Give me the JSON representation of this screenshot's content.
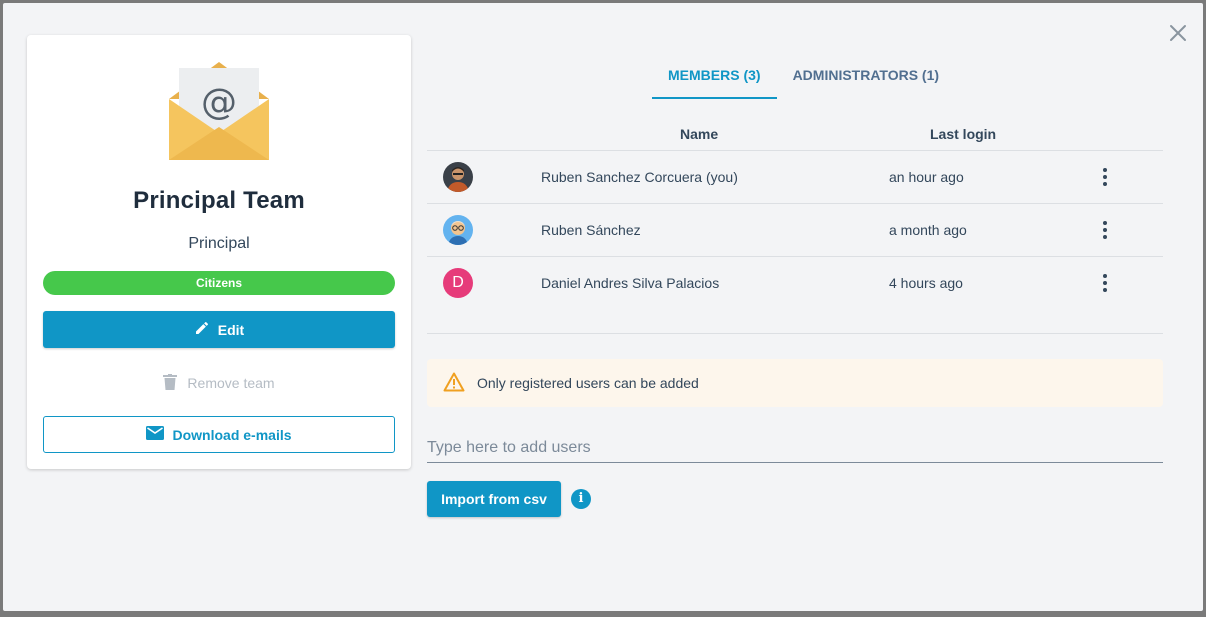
{
  "team": {
    "name": "Principal Team",
    "subtitle": "Principal",
    "badge": "Citizens",
    "edit_label": "Edit",
    "remove_label": "Remove team",
    "download_label": "Download e-mails"
  },
  "tabs": [
    {
      "label": "MEMBERS (3)",
      "active": true
    },
    {
      "label": "ADMINISTRATORS (1)",
      "active": false
    }
  ],
  "table": {
    "columns": [
      "Name",
      "Last login"
    ],
    "rows": [
      {
        "name": "Ruben Sanchez Corcuera (you)",
        "last_login": "an hour ago",
        "avatar": "photo-avatar"
      },
      {
        "name": "Ruben Sánchez",
        "last_login": "a month ago",
        "avatar": "cartoon-avatar"
      },
      {
        "name": "Daniel Andres Silva Palacios",
        "last_login": "4 hours ago",
        "avatar": "letter-avatar",
        "initial": "D"
      }
    ]
  },
  "alert": {
    "text": "Only registered users can be added"
  },
  "add_users": {
    "placeholder": "Type here to add users"
  },
  "import_label": "Import from csv",
  "colors": {
    "accent": "#1096c6",
    "badge_green": "#46c84b",
    "warning": "#f0a020",
    "letter_avatar": "#e63b7a"
  }
}
